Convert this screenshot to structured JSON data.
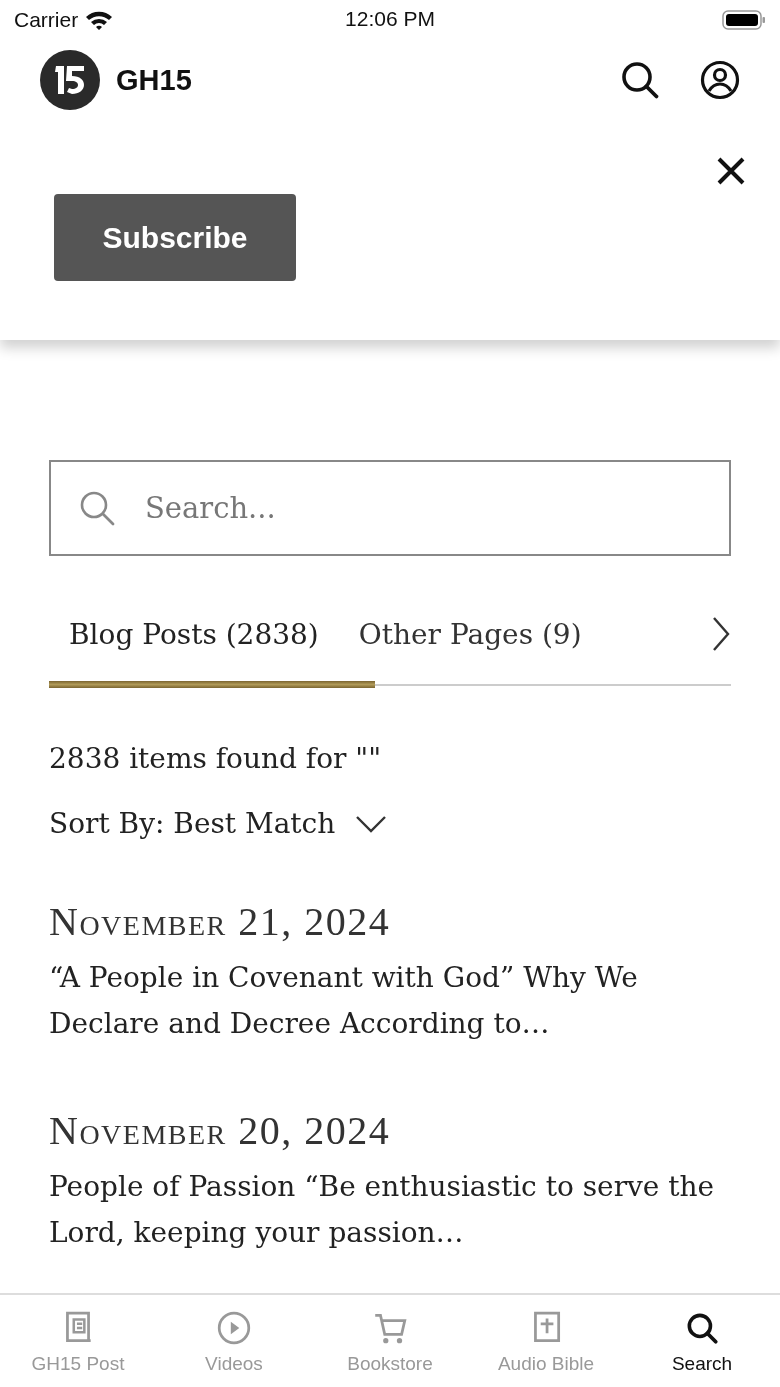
{
  "status_bar": {
    "carrier": "Carrier",
    "time": "12:06 PM"
  },
  "header": {
    "title": "GH15"
  },
  "subscribe_panel": {
    "button": "Subscribe"
  },
  "search": {
    "placeholder": "Search..."
  },
  "tabs": [
    {
      "label": "Blog Posts (2838)",
      "selected": true
    },
    {
      "label": "Other Pages (9)",
      "selected": false
    }
  ],
  "result_count": "2838 items found for \"\"",
  "sort": "Sort By: Best Match",
  "results": [
    {
      "date": "November 21, 2024",
      "title": "“A People in Covenant with God” Why We Declare and Decree According to…"
    },
    {
      "date": "November 20, 2024",
      "title": "People of Passion “Be enthusiastic to serve the Lord, keeping your passion…"
    }
  ],
  "tab_bar": [
    {
      "label": "GH15 Post",
      "selected": false
    },
    {
      "label": "Videos",
      "selected": false
    },
    {
      "label": "Bookstore",
      "selected": false
    },
    {
      "label": "Audio Bible",
      "selected": false
    },
    {
      "label": "Search",
      "selected": true
    }
  ]
}
